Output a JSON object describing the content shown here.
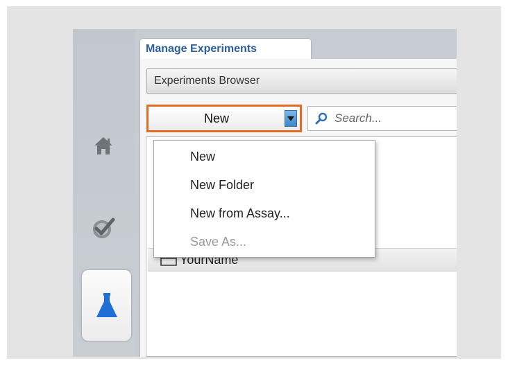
{
  "tab": {
    "title": "Manage Experiments"
  },
  "browser": {
    "title": "Experiments Browser"
  },
  "toolbar": {
    "new_label": "New",
    "search_placeholder": "Search..."
  },
  "dropdown_menu": {
    "items": [
      {
        "label": "New",
        "enabled": true
      },
      {
        "label": "New Folder",
        "enabled": true
      },
      {
        "label": "New from Assay...",
        "enabled": true
      },
      {
        "label": "Save As...",
        "enabled": false
      }
    ]
  },
  "tree": {
    "items": [
      {
        "label": "YourName",
        "icon": "folder-icon"
      }
    ]
  },
  "sidebar": {
    "items": [
      {
        "icon": "home-icon"
      },
      {
        "icon": "checkmark-icon"
      },
      {
        "icon": "flask-icon",
        "selected": true
      }
    ]
  },
  "colors": {
    "accent_highlight": "#e56b22",
    "tab_title": "#2d5f9e",
    "flask": "#1f6fd6",
    "sidebar_bg": "#c6ccd2",
    "frame_bg": "#e4e4e4"
  }
}
